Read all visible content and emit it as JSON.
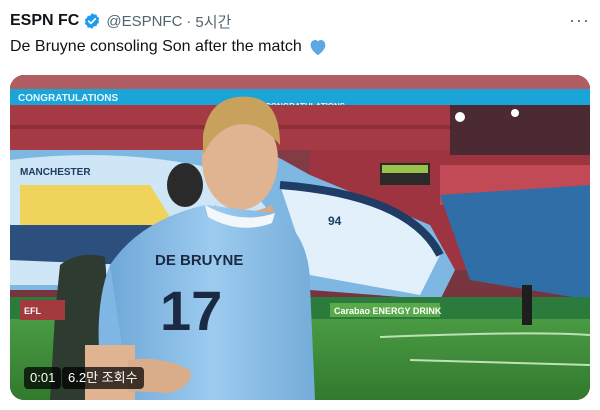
{
  "tweet": {
    "author_name": "ESPN FC",
    "handle": "@ESPNFC",
    "separator": "·",
    "time": "5시간",
    "text": "De Bruyne consoling Son after the match",
    "more_label": "···"
  },
  "video": {
    "timestamp": "0:01",
    "views": "6.2만 조회수",
    "banner_text_1": "CONGRATULATIONS",
    "banner_text_2": "CONGRATULATIONS",
    "ad_board": "Carabao ENERGY DRINK",
    "jersey_name": "DE BRUYNE",
    "jersey_number": "17",
    "crest_text": "EFL",
    "flag_number": "94",
    "flag_text": "MANCHESTER"
  },
  "colors": {
    "verified": "#1d9bf0",
    "heart": "#5aa9e6",
    "pitch": "#3f8a3a",
    "kit_blue": "#8ec3ea"
  }
}
